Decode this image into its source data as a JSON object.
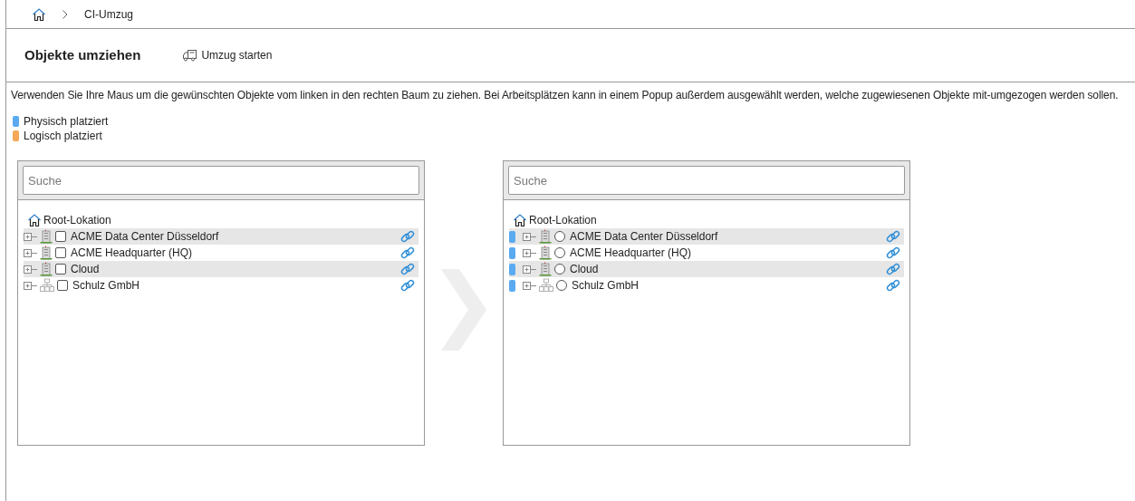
{
  "breadcrumb": {
    "current": "CI-Umzug"
  },
  "header": {
    "title": "Objekte umziehen",
    "action": "Umzug starten"
  },
  "instructions": "Verwenden Sie Ihre Maus um die gewünschten Objekte vom linken in den rechten Baum zu ziehen. Bei Arbeitsplätzen kann in einem Popup außerdem ausgewählt werden, welche zugewiesenen Objekte mit-umgezogen werden sollen.",
  "legend": [
    {
      "label": "Physisch platziert",
      "color": "#5aaaf0"
    },
    {
      "label": "Logisch platziert",
      "color": "#f4a85a"
    }
  ],
  "trees": [
    {
      "search_placeholder": "Suche",
      "root": "Root-Lokation",
      "kind": "checkbox",
      "items": [
        {
          "label": "ACME Data Center Düsseldorf",
          "kind": "building",
          "checked": false
        },
        {
          "label": "ACME Headquarter (HQ)",
          "kind": "building",
          "checked": false
        },
        {
          "label": "Cloud",
          "kind": "building",
          "checked": false
        },
        {
          "label": "Schulz GmbH",
          "kind": "organization",
          "checked": false
        }
      ]
    },
    {
      "search_placeholder": "Suche",
      "root": "Root-Lokation",
      "kind": "radio",
      "items": [
        {
          "label": "ACME Data Center Düsseldorf",
          "kind": "building",
          "selected": false,
          "color": "#5aaaf0"
        },
        {
          "label": "ACME Headquarter (HQ)",
          "kind": "building",
          "selected": false,
          "color": "#5aaaf0"
        },
        {
          "label": "Cloud",
          "kind": "building",
          "selected": false,
          "color": "#5aaaf0"
        },
        {
          "label": "Schulz GmbH",
          "kind": "organization",
          "selected": false,
          "color": "#5aaaf0"
        }
      ]
    }
  ]
}
